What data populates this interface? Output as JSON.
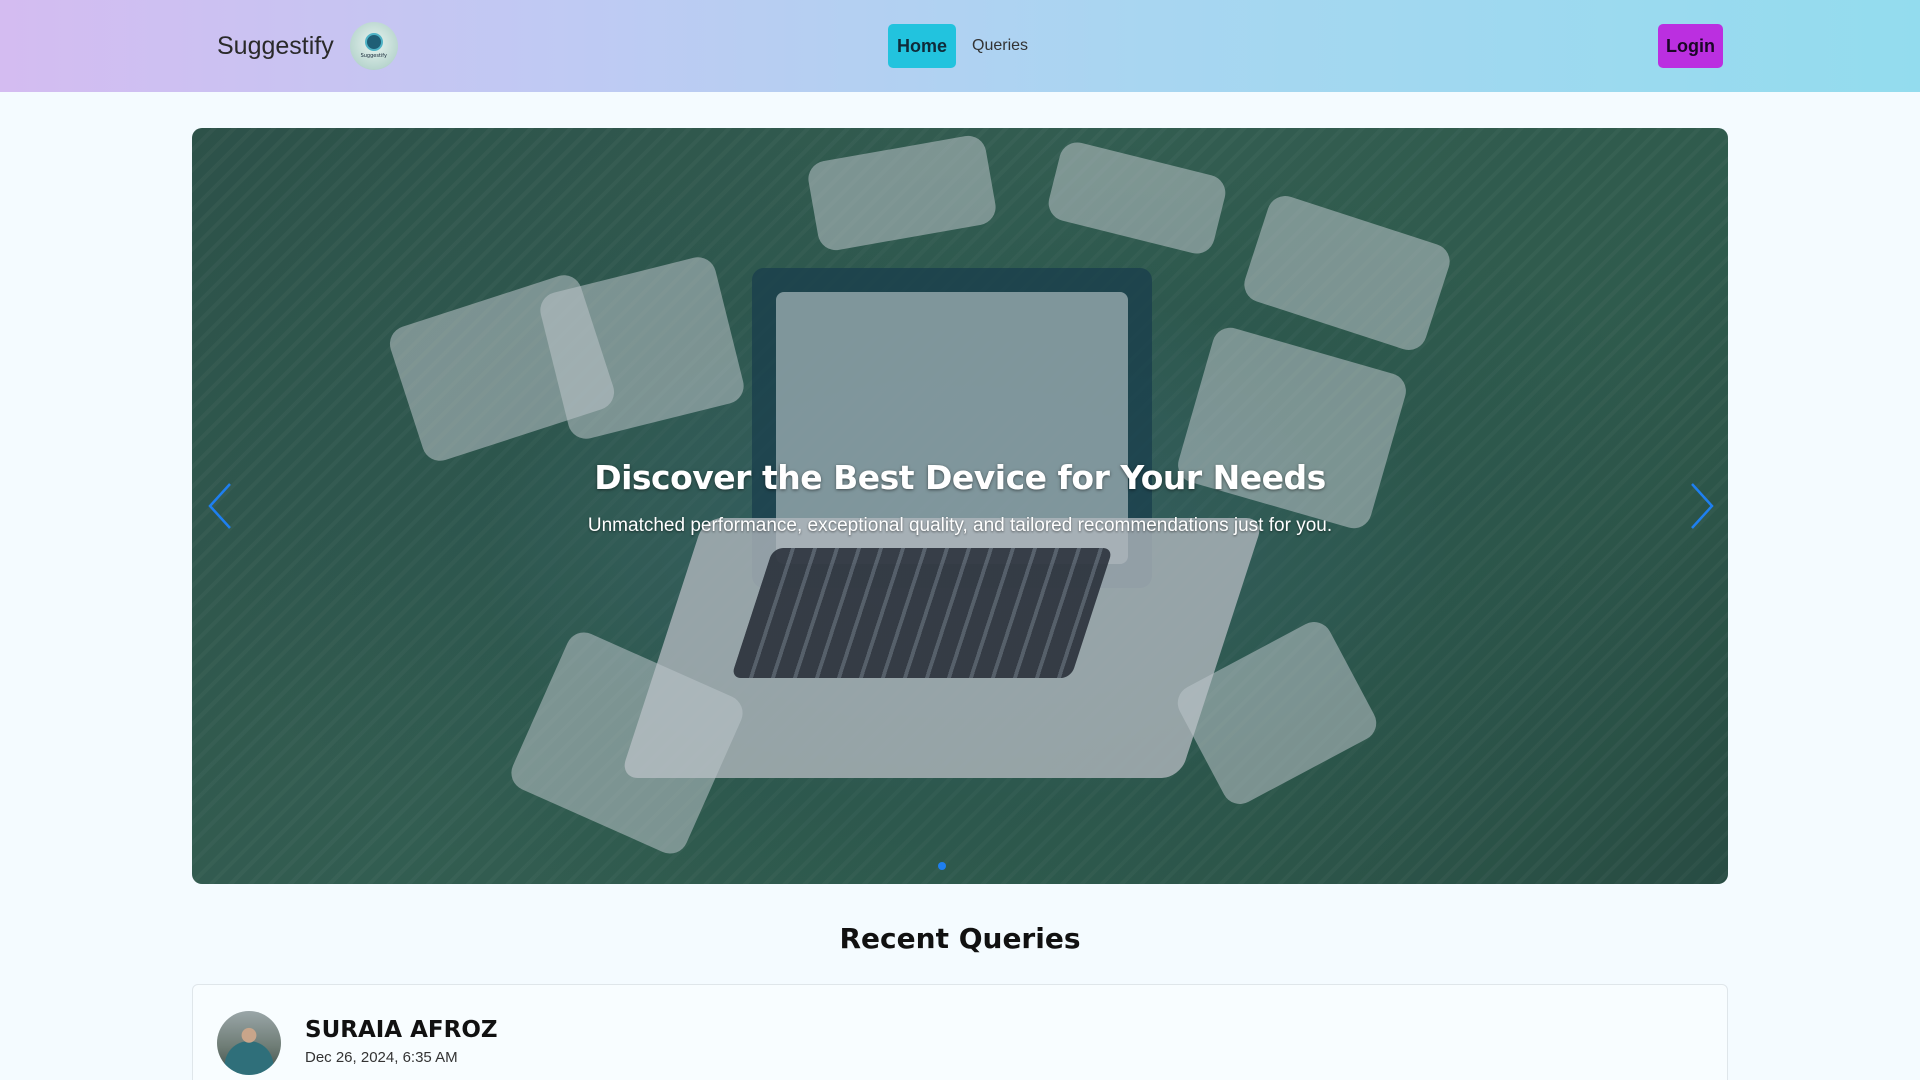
{
  "navbar": {
    "brand": "Suggestify",
    "logo_text": "Suggestify",
    "links": [
      {
        "label": "Home",
        "active": true
      },
      {
        "label": "Queries",
        "active": false
      }
    ],
    "login_label": "Login"
  },
  "carousel": {
    "title": "Discover the Best Device for Your Needs",
    "subtitle": "Unmatched performance, exceptional quality, and tailored recommendations just for you.",
    "prev_icon": "chevron-left-icon",
    "next_icon": "chevron-right-icon",
    "active_slide": 1,
    "slide_count": 1
  },
  "recent": {
    "title": "Recent Queries",
    "items": [
      {
        "author": "SURAIA AFROZ",
        "date": "Dec 26, 2024, 6:35 AM"
      }
    ]
  },
  "colors": {
    "home_button": "#22c3de",
    "login_button": "#bb2fe0",
    "carousel_arrow": "#1e7ff0"
  }
}
